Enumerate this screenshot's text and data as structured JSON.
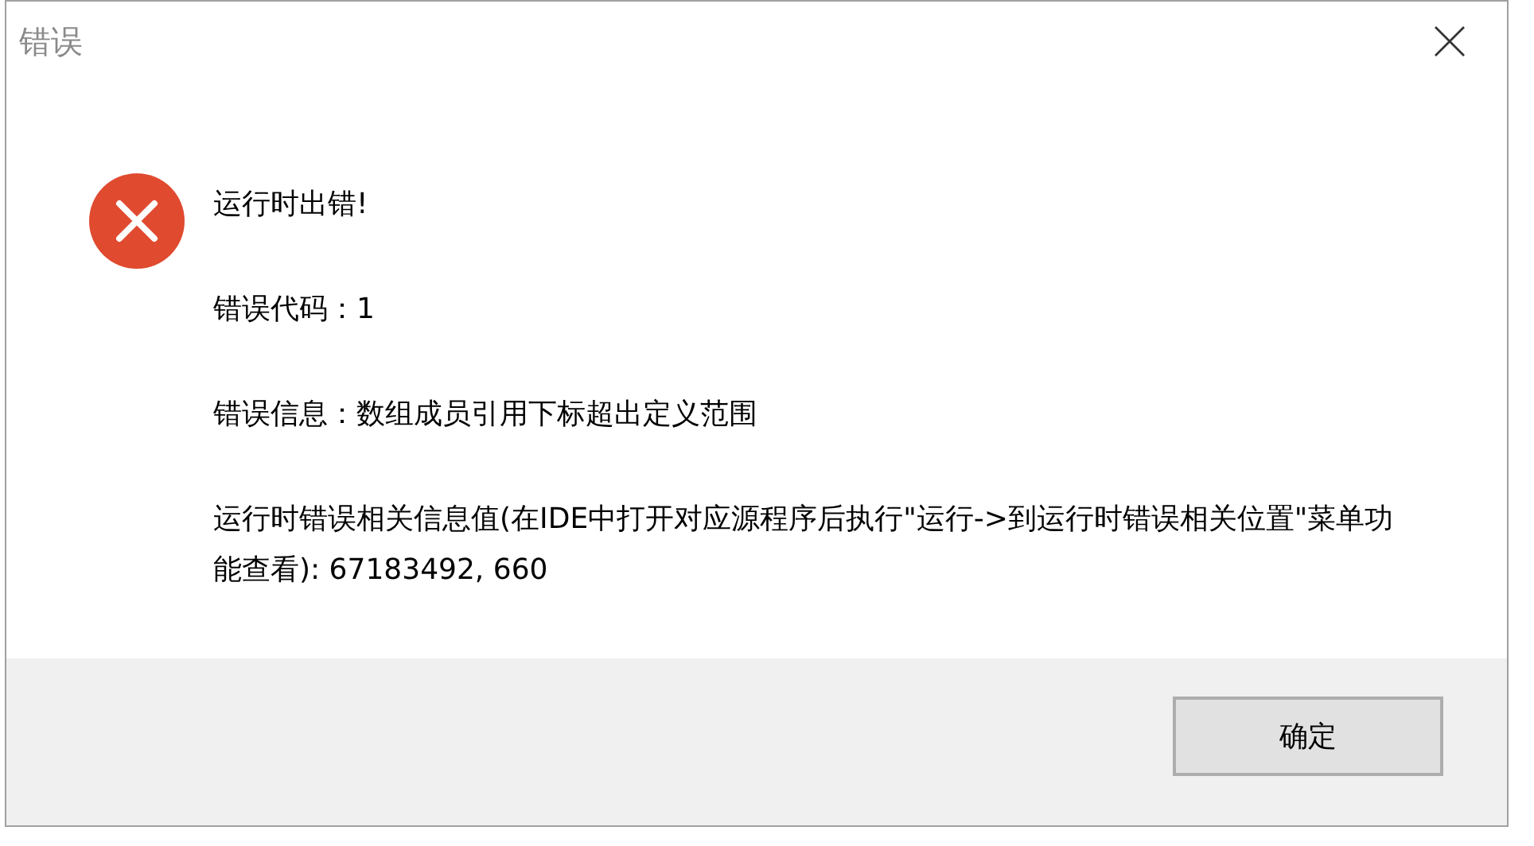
{
  "window": {
    "title": "错误"
  },
  "message": {
    "kind": "error",
    "paragraphs": [
      "运行时出错!",
      "错误代码：1",
      "错误信息：数组成员引用下标超出定义范围",
      "运行时错误相关信息值(在IDE中打开对应源程序后执行\"运行->到运行时错误相关位置\"菜单功能查看): 67183492, 660"
    ]
  },
  "buttons": [
    "确定"
  ]
}
